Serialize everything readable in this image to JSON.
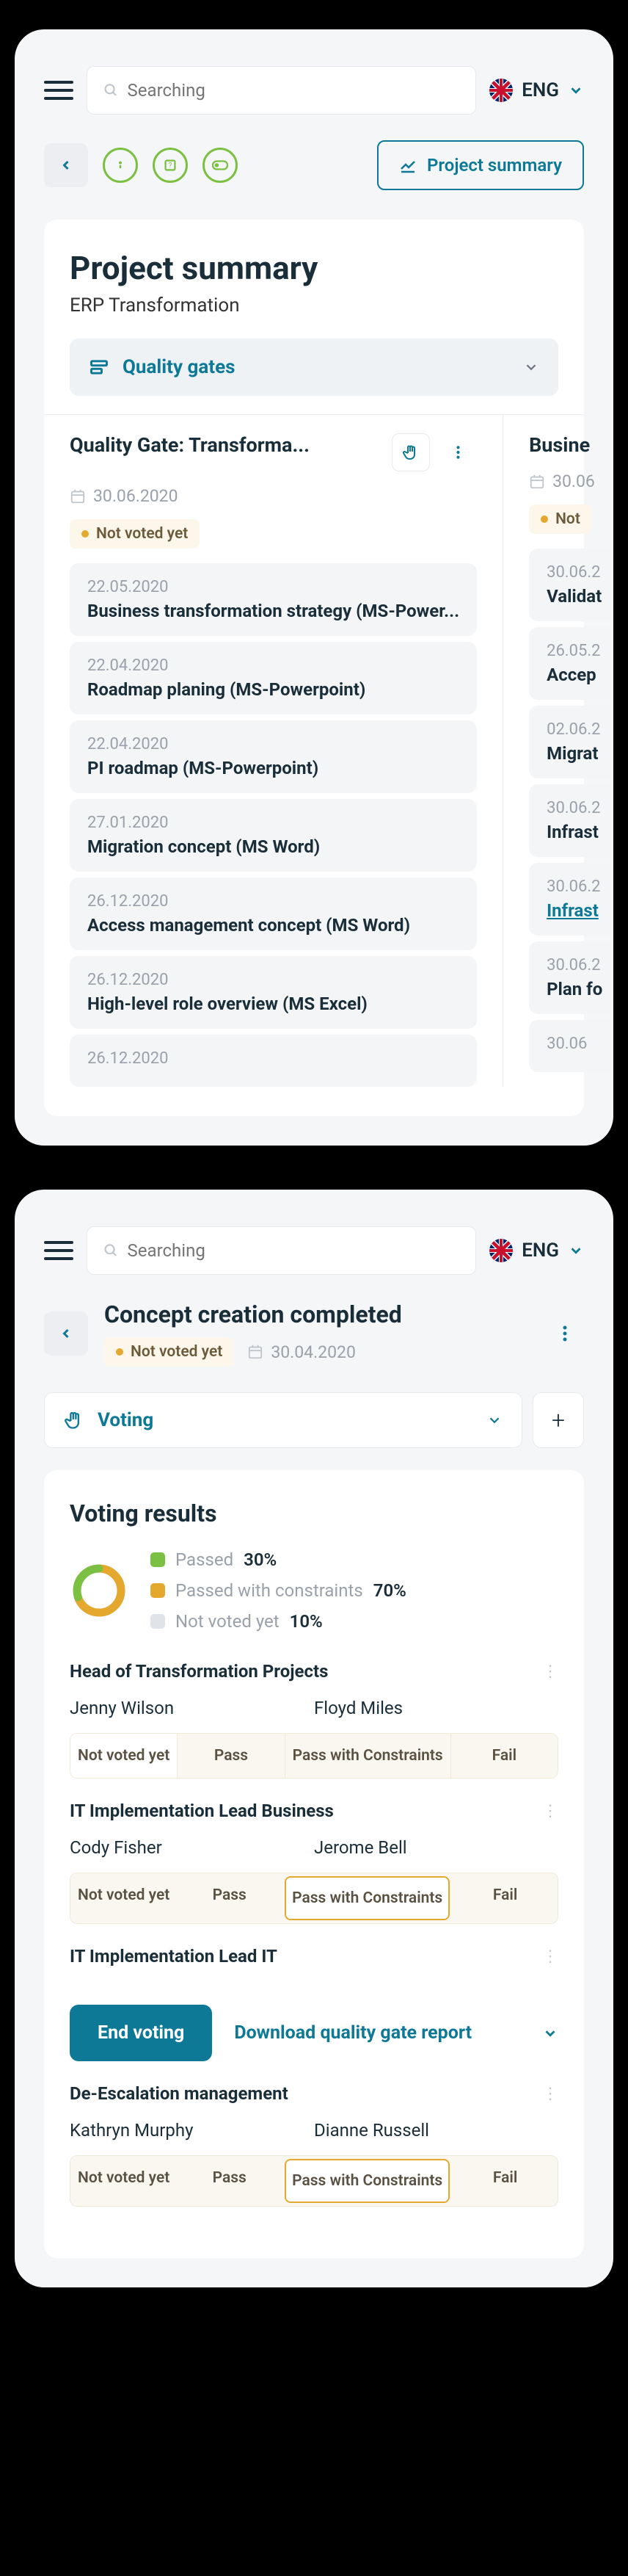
{
  "search": {
    "placeholder": "Searching"
  },
  "lang": {
    "code": "ENG"
  },
  "screen1": {
    "summary_btn": "Project summary",
    "title": "Project summary",
    "subtitle": "ERP Transformation",
    "quality_gates_label": "Quality gates",
    "columns": [
      {
        "title": "Quality Gate: Transforma...",
        "date": "30.06.2020",
        "badge": "Not voted yet",
        "items": [
          {
            "date": "22.05.2020",
            "title": "Business transformation strategy (MS-Power..."
          },
          {
            "date": "22.04.2020",
            "title": "Roadmap planing (MS-Powerpoint)"
          },
          {
            "date": "22.04.2020",
            "title": "PI roadmap (MS-Powerpoint)"
          },
          {
            "date": "27.01.2020",
            "title": "Migration concept (MS Word)"
          },
          {
            "date": "26.12.2020",
            "title": "Access management concept (MS Word)"
          },
          {
            "date": "26.12.2020",
            "title": "High-level role overview (MS Excel)"
          },
          {
            "date": "26.12.2020",
            "title": ""
          }
        ]
      },
      {
        "title": "Busine",
        "date": "30.06",
        "badge": "Not",
        "items": [
          {
            "date": "30.06.2",
            "title": "Validat"
          },
          {
            "date": "26.05.2",
            "title": "Accep"
          },
          {
            "date": "02.06.2",
            "title": "Migrat"
          },
          {
            "date": "30.06.2",
            "title": "Infrast"
          },
          {
            "date": "30.06.2",
            "title": "Infrast",
            "link": true
          },
          {
            "date": "30.06.2",
            "title": "Plan fo"
          },
          {
            "date": "30.06",
            "title": ""
          }
        ]
      }
    ]
  },
  "screen2": {
    "title": "Concept creation completed",
    "badge": "Not voted yet",
    "date": "30.04.2020",
    "voting_label": "Voting",
    "results_title": "Voting results",
    "legend": [
      {
        "label": "Passed",
        "val": "30%",
        "color": "#7bc043"
      },
      {
        "label": "Passed with constraints",
        "val": "70%",
        "color": "#e5a82e"
      },
      {
        "label": "Not voted yet",
        "val": "10%",
        "color": "#e0e3e8"
      }
    ],
    "roles": [
      {
        "heading": "Head of Transformation Projects",
        "names": [
          "Jenny Wilson",
          "Floyd Miles"
        ],
        "opts": [
          "Not voted yet",
          "Pass",
          "Pass with Constraints",
          "Fail"
        ],
        "style": "white-first"
      },
      {
        "heading": "IT Implementation Lead Business",
        "names": [
          "Cody Fisher",
          "Jerome Bell"
        ],
        "opts": [
          "Not voted yet",
          "Pass",
          "Pass with Constraints",
          "Fail"
        ],
        "style": "outlined-third"
      },
      {
        "heading": "IT Implementation Lead IT",
        "names": [
          "",
          ""
        ]
      },
      {
        "heading": "De-Escalation management",
        "names": [
          "Kathryn Murphy",
          "Dianne Russell"
        ],
        "opts": [
          "Not voted yet",
          "Pass",
          "Pass with Constraints",
          "Fail"
        ],
        "style": "outlined-third"
      }
    ],
    "end_voting": "End voting",
    "download": "Download quality gate report",
    "chart_data": {
      "type": "pie",
      "title": "Voting results",
      "series": [
        {
          "name": "Passed",
          "value": 30,
          "color": "#7bc043"
        },
        {
          "name": "Passed with constraints",
          "value": 70,
          "color": "#e5a82e"
        },
        {
          "name": "Not voted yet",
          "value": 10,
          "color": "#e0e3e8"
        }
      ]
    }
  }
}
